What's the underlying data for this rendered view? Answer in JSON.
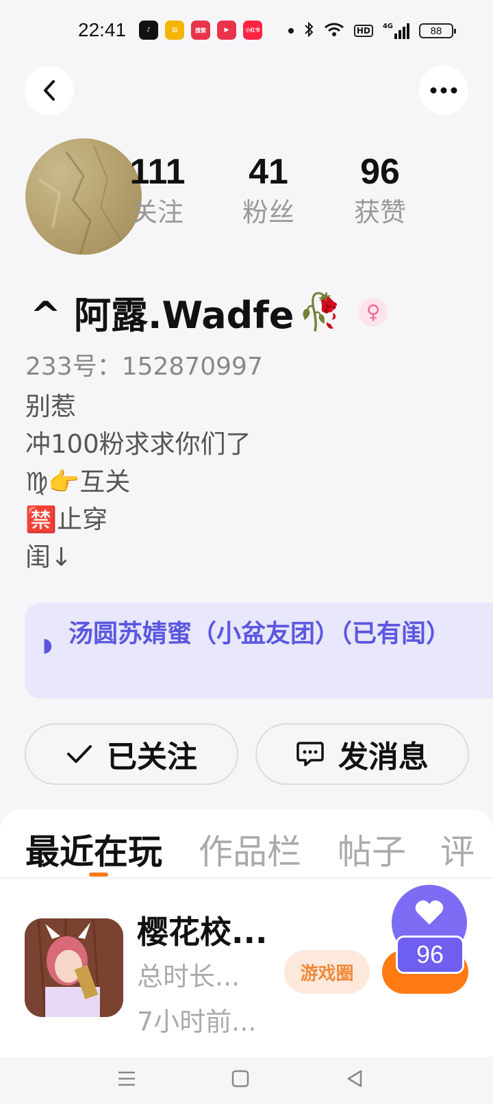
{
  "status_bar": {
    "time": "22:41",
    "apps": [
      {
        "icon": "tiktok-icon",
        "color": "#111111",
        "label": "♪"
      },
      {
        "icon": "book-icon",
        "color": "#f5b400",
        "label": "▤"
      },
      {
        "icon": "search-app-icon",
        "color": "#e8344b",
        "label": "搜索"
      },
      {
        "icon": "video-app-icon",
        "color": "#e8344b",
        "label": "▶"
      },
      {
        "icon": "xiaohongshu-icon",
        "color": "#ff2442",
        "label": "小红书"
      }
    ],
    "network": "4G",
    "hd": "HD",
    "battery": "88"
  },
  "profile": {
    "stats": [
      {
        "value": "111",
        "label": "关注"
      },
      {
        "value": "41",
        "label": "粉丝"
      },
      {
        "value": "96",
        "label": "获赞"
      }
    ],
    "nickname": "^ 阿露.Wadfe",
    "nickname_emoji": "🥀",
    "gender_symbol": "♀",
    "uid": "233号：152870997",
    "bio_lines": [
      "别惹",
      "冲100粉求求你们了",
      "♍👉互关",
      "🈲止穿",
      "闺↓"
    ],
    "club_text": "汤圆苏婧蜜（小盆友团）（已有闺）"
  },
  "actions": {
    "follow_label": "已关注",
    "message_label": "发消息"
  },
  "tabs": [
    "最近在玩",
    "作品栏",
    "帖子",
    "评"
  ],
  "recent_game": {
    "title": "樱花校...",
    "duration": "总时长...",
    "last_played": "7小时前...",
    "circle_label": "游戏圈"
  },
  "likes_float": {
    "count": "96"
  },
  "colors": {
    "accent_orange": "#ff7a12",
    "club_purple": "#5b57e0",
    "like_purple": "#7c6cf4"
  }
}
